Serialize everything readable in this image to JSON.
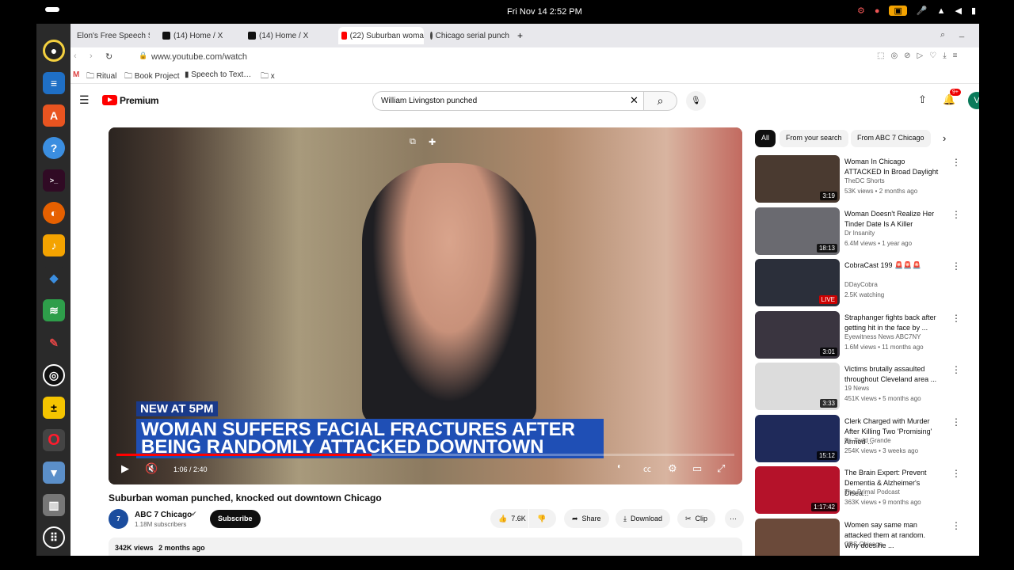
{
  "system": {
    "clock": "Fri Nov 14   2:52 PM"
  },
  "browser": {
    "tabs": [
      {
        "label": "Elon's Free Speech S",
        "color": "#2e9e4a"
      },
      {
        "label": "(14) Home / X",
        "color": "#111111"
      },
      {
        "label": "(14) Home / X",
        "color": "#111111"
      },
      {
        "label": "(22) Suburban woma",
        "color": "#ff0000"
      },
      {
        "label": "Chicago serial punch",
        "color": "#444444"
      }
    ],
    "url": "www.youtube.com/watch",
    "bookmarks": [
      "Ritual",
      "Book Project",
      "Speech to Text…",
      "x"
    ]
  },
  "youtube": {
    "logo": "Premium",
    "search_value": "William Livingston punched",
    "notif_badge": "9+",
    "avatar_letter": "V",
    "chips": [
      "All",
      "From your search",
      "From ABC 7 Chicago"
    ],
    "player": {
      "badge": "NEW AT 5PM",
      "headline_1": "WOMAN SUFFERS FACIAL FRACTURES AFTER",
      "headline_2": "BEING RANDOMLY ATTACKED DOWNTOWN",
      "time": "1:06 / 2:40",
      "progress": 0.4125
    },
    "video": {
      "title": "Suburban woman punched, knocked out downtown Chicago",
      "channel": "ABC 7 Chicago",
      "subscribers": "1.18M subscribers",
      "subscribe_label": "Subscribe",
      "likes": "7.6K",
      "share_label": "Share",
      "download_label": "Download",
      "clip_label": "Clip",
      "views": "342K views",
      "age": "2 months ago"
    },
    "related": [
      {
        "title": "Woman In Chicago ATTACKED In Broad Daylight",
        "channel": "TheDC Shorts",
        "meta": "53K views • 2 months ago",
        "duration": "3:19",
        "thumb": "#4a3a30"
      },
      {
        "title": "Woman Doesn't Realize Her Tinder Date Is A Killer",
        "channel": "Dr Insanity",
        "meta": "6.4M views • 1 year ago",
        "duration": "18:13",
        "thumb": "#6a6a70"
      },
      {
        "title": "CobraCast 199 🚨🚨🚨",
        "channel": "DDayCobra",
        "meta": "2.5K watching",
        "duration": "LIVE",
        "thumb": "#2b2f3a"
      },
      {
        "title": "Straphanger fights back after getting hit in the face by ...",
        "channel": "Eyewitness News ABC7NY",
        "meta": "1.6M views • 11 months ago",
        "duration": "3:01",
        "thumb": "#3a3540"
      },
      {
        "title": "Victims brutally assaulted throughout Cleveland area ...",
        "channel": "19 News",
        "meta": "451K views • 5 months ago",
        "duration": "3:33",
        "thumb": "#dcdcdc"
      },
      {
        "title": "Clerk Charged with Murder After Killing Two 'Promising' Armed ...",
        "channel": "Dr. Todd Grande",
        "meta": "254K views • 3 weeks ago",
        "duration": "15:12",
        "thumb": "#1f2a5a"
      },
      {
        "title": "The Brain Expert: Prevent Dementia & Alzheimer's Disea...",
        "channel": "The Primal Podcast",
        "meta": "363K views • 9 months ago",
        "duration": "1:17:42",
        "thumb": "#b5122a"
      },
      {
        "title": "Women say same man attacked them at random. Why does he ...",
        "channel": "CBS Chicago",
        "meta": "",
        "duration": "",
        "thumb": "#6b4a3a"
      }
    ]
  }
}
